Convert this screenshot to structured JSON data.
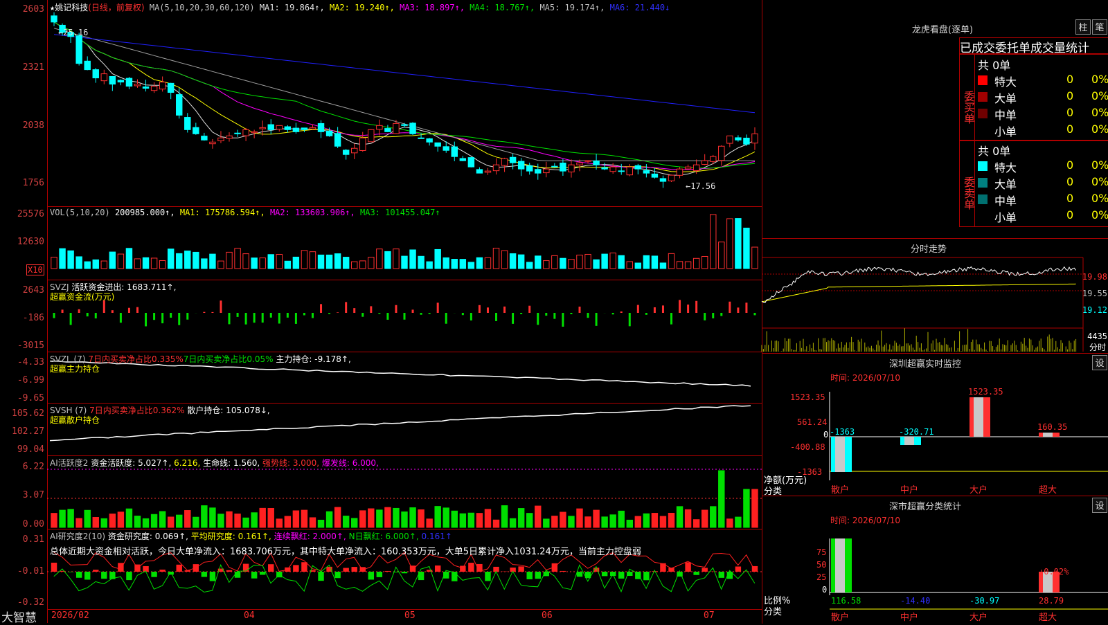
{
  "stock": {
    "title": "姚记科技",
    "mode": "(日线，前复权)",
    "star": "★"
  },
  "ma_line": {
    "label": "MA(5,10,20,30,60,120)",
    "ma1": "MA1: 19.864↑,",
    "ma2": "MA2: 19.240↑,",
    "ma3": "MA3: 18.897↑,",
    "ma4": "MA4: 18.767↑,",
    "ma5": "MA5: 19.174↑,",
    "ma6": "MA6: 21.440↓"
  },
  "price_axis": [
    "2603",
    "2321",
    "2038",
    "1756"
  ],
  "price_annotations": {
    "high": "←25.16",
    "low": "←17.56"
  },
  "vol_header": {
    "label": "VOL(5,10,20)",
    "value": "200985.000↑,",
    "ma1": "MA1: 175786.594↑,",
    "ma2": "MA2: 133603.906↑,",
    "ma3": "MA3: 101455.047↑"
  },
  "vol_axis": [
    "25576",
    "12630"
  ],
  "vol_unit": "X10",
  "svzj": {
    "label": "SVZJ",
    "text": "活跃资金进出: 1683.711↑,",
    "sub": "超赢资金流(万元)"
  },
  "svzj_axis": [
    "2643",
    "-186",
    "-3015"
  ],
  "svzl": {
    "label": "SVZL (7)",
    "p1": "7日内买卖净占比0.335%",
    "p2": "7日内买卖净占比0.05%",
    "p3": "主力持仓: -9.178↑,",
    "sub": "超赢主力持仓"
  },
  "svzl_axis": [
    "-4.33",
    "-6.99",
    "-9.65"
  ],
  "svsh": {
    "label": "SVSH (7)",
    "p1": "7日内买卖净占比0.362%",
    "p2": "散户持仓: 105.078↓,",
    "sub": "超赢散户持仓"
  },
  "svsh_axis": [
    "105.62",
    "102.27",
    "99.04"
  ],
  "ai1": {
    "label": "AI活跃度2",
    "v1": "资金活跃度: 5.027↑,",
    "v2": "6.216,",
    "v3": "生命线: 1.560,",
    "v4": "强势线: 3.000,",
    "v5": "爆发线: 6.000,"
  },
  "ai1_axis": [
    "6.22",
    "3.07",
    "0.00"
  ],
  "ai2": {
    "label": "AI研究度2(10)",
    "v1": "资金研究度: 0.069↑,",
    "v2": "平均研究度: 0.161↑,",
    "v3": "连续飘红: 2.000↑,",
    "v4": "N日飘红: 6.000↑,",
    "v5": "0.161↑",
    "summary": "总体近期大资金相对活跃，今日大单净流入：1683.706万元，其中特大单净流入：160.353万元，大单5日累计净入1031.24万元，当前主力控盘弱"
  },
  "ai2_axis": [
    "0.31",
    "-0.01",
    "-0.32"
  ],
  "date_axis": [
    "2026/02",
    "04",
    "05",
    "06",
    "07"
  ],
  "brand": "大智慧",
  "right": {
    "lhb_title": "龙虎看盘(逐单)",
    "btn_zhu": "柱",
    "btn_bi": "笔",
    "table_title": "已成交委托单成交量统计",
    "buy": {
      "side": "委买单",
      "total": "共 0单",
      "rows": [
        {
          "name": "特大",
          "v": "0",
          "p": "0%",
          "color": "#ff0000"
        },
        {
          "name": "大单",
          "v": "0",
          "p": "0%",
          "color": "#a00000"
        },
        {
          "name": "中单",
          "v": "0",
          "p": "0%",
          "color": "#700000"
        },
        {
          "name": "小单",
          "v": "0",
          "p": "0%",
          "color": ""
        }
      ]
    },
    "sell": {
      "side": "委卖单",
      "total": "共 0单",
      "rows": [
        {
          "name": "特大",
          "v": "0",
          "p": "0%",
          "color": "#00ffff"
        },
        {
          "name": "大单",
          "v": "0",
          "p": "0%",
          "color": "#008080"
        },
        {
          "name": "中单",
          "v": "0",
          "p": "0%",
          "color": "#007070"
        },
        {
          "name": "小单",
          "v": "0",
          "p": "0%",
          "color": ""
        }
      ]
    },
    "intraday_title": "分时走势",
    "intraday_axis": [
      "19.98",
      "19.55",
      "19.12"
    ],
    "intraday_vol": "4435",
    "intraday_foot": "分时",
    "sz_title": "深圳超赢实时监控",
    "btn_set": "设",
    "sz_time": "时间: 2026/07/10",
    "sz_axis": [
      "1523.35",
      "561.24",
      "0",
      "-400.88",
      "-1363"
    ],
    "sz_bars": {
      "categories": [
        "散户",
        "中户",
        "大户",
        "超大"
      ],
      "values": [
        -1363,
        -320.71,
        1523.35,
        160.35
      ],
      "labels": [
        "-1363",
        "-320.71",
        "1523.35",
        "160.35"
      ]
    },
    "sz_ylabel": "净额(万元)",
    "sz_xlabel": "分类",
    "cls_title": "深市超赢分类统计",
    "cls_time": "时间: 2026/07/10",
    "cls_axis": [
      "75",
      "50",
      "25",
      "0"
    ],
    "cls_ylabel": "比例%",
    "cls_xlabel": "分类",
    "cls_bars": {
      "categories": [
        "散户",
        "中户",
        "大户",
        "超大"
      ],
      "values": [
        116.58,
        -14.4,
        -30.97,
        28.79
      ],
      "labels": [
        "116.58",
        "-14.40",
        "-30.97",
        "28.79"
      ],
      "extra": "+0.02%"
    }
  },
  "chart_data": [
    {
      "type": "table",
      "title": "深圳超赢实时监控",
      "categories": [
        "散户",
        "中户",
        "大户",
        "超大"
      ],
      "values": [
        -1363,
        -320.71,
        1523.35,
        160.35
      ],
      "ylabel": "净额(万元)",
      "xlabel": "分类",
      "ylim": [
        -1363,
        1523.35
      ]
    },
    {
      "type": "bar",
      "title": "深市超赢分类统计",
      "categories": [
        "散户",
        "中户",
        "大户",
        "超大"
      ],
      "values": [
        116.58,
        -14.4,
        -30.97,
        28.79
      ],
      "ylabel": "比例%",
      "xlabel": "分类",
      "ylim": [
        0,
        75
      ]
    }
  ],
  "colors": {
    "up": "#ff3030",
    "down": "#00ffff",
    "grid": "#b00000",
    "yellow": "#ffff00",
    "magenta": "#ff00ff",
    "green": "#00e000",
    "blue": "#2020ff"
  }
}
